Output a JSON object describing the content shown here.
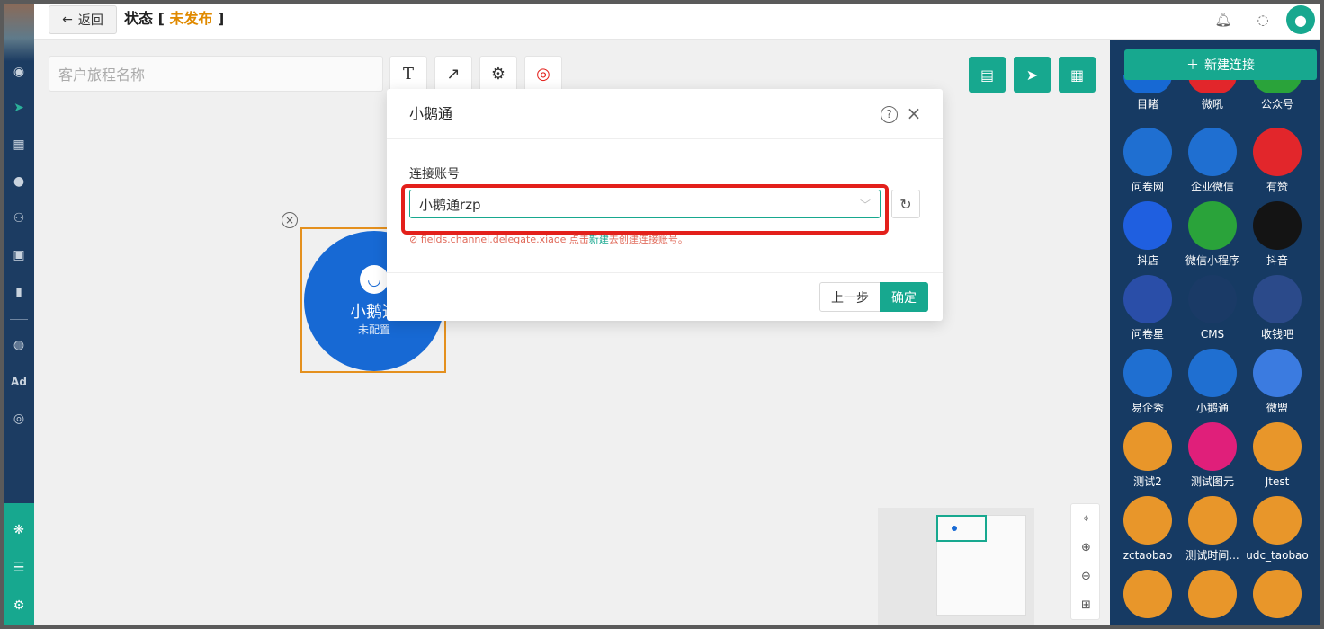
{
  "header": {
    "back_label": "返回",
    "title_prefix": "状态 [ ",
    "status": "未发布",
    "title_suffix": " ]"
  },
  "toolbar": {
    "journey_name_placeholder": "客户旅程名称"
  },
  "node": {
    "name": "小鹅通",
    "status": "未配置"
  },
  "right_panel": {
    "new_connection_label": "新建连接",
    "components": [
      {
        "label": "目睹",
        "color": "#1769d4"
      },
      {
        "label": "微吼",
        "color": "#e2262b"
      },
      {
        "label": "公众号",
        "color": "#2aa33a"
      },
      {
        "label": "问卷网",
        "color": "#1f6fd1"
      },
      {
        "label": "企业微信",
        "color": "#1f6fd1"
      },
      {
        "label": "有赞",
        "color": "#e2262b"
      },
      {
        "label": "抖店",
        "color": "#1f5fe0"
      },
      {
        "label": "微信小程序",
        "color": "#2aa33a"
      },
      {
        "label": "抖音",
        "color": "#141414"
      },
      {
        "label": "问卷星",
        "color": "#2a4ea8"
      },
      {
        "label": "CMS",
        "color": "#1a3a66"
      },
      {
        "label": "收钱吧",
        "color": "#2b4a8a"
      },
      {
        "label": "易企秀",
        "color": "#1f6fd1"
      },
      {
        "label": "小鹅通",
        "color": "#1f6fd1"
      },
      {
        "label": "微盟",
        "color": "#3b7be0"
      },
      {
        "label": "测试2",
        "color": "#e8962a"
      },
      {
        "label": "测试图元",
        "color": "#e01f7a"
      },
      {
        "label": "Jtest",
        "color": "#e8962a"
      },
      {
        "label": "zctaobao",
        "color": "#e8962a"
      },
      {
        "label": "测试时间...",
        "color": "#e8962a"
      },
      {
        "label": "udc_taobao",
        "color": "#e8962a"
      },
      {
        "label": "",
        "color": "#e8962a"
      },
      {
        "label": "",
        "color": "#e8962a"
      },
      {
        "label": "",
        "color": "#e8962a"
      }
    ]
  },
  "dialog": {
    "title": "小鹅通",
    "field_label": "连接账号",
    "selected_account": "小鹅通rzp",
    "error_text": "fields.channel.delegate.xiaoe 点击",
    "error_link": "新建",
    "error_tail": "去创建连接账号。",
    "prev_label": "上一步",
    "ok_label": "确定"
  },
  "colors": {
    "accent": "#17a88f",
    "sidebar": "#1c3c62",
    "panel": "#163a63",
    "status": "#e08a00",
    "highlight": "#e3201b"
  }
}
